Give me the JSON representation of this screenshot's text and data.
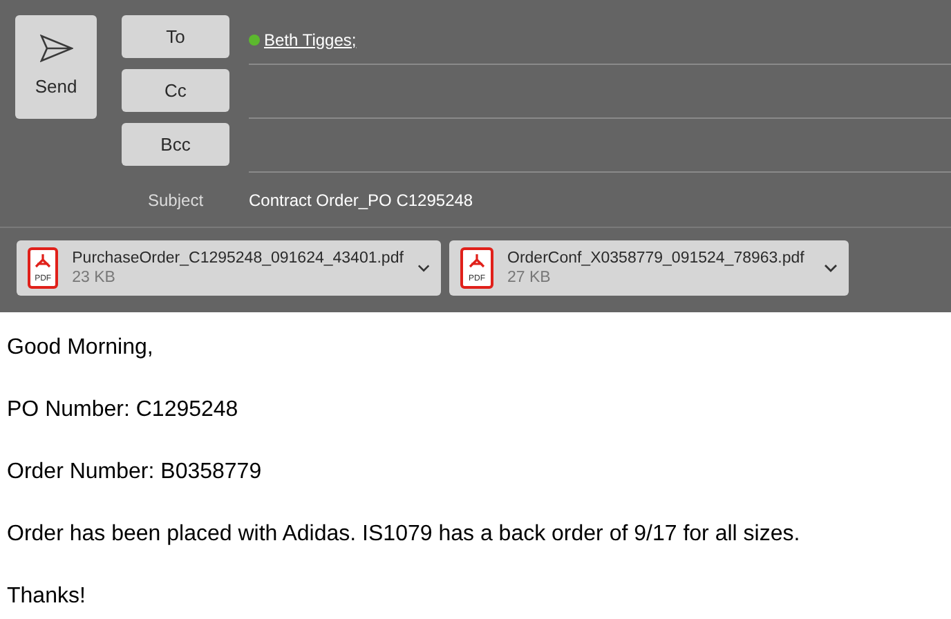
{
  "send_button": {
    "label": "Send"
  },
  "address_rows": [
    {
      "button": "To",
      "recipients": [
        {
          "name": "Beth Tigges;",
          "color": "#5cb82e"
        }
      ]
    },
    {
      "button": "Cc",
      "recipients": []
    },
    {
      "button": "Bcc",
      "recipients": []
    }
  ],
  "subject": {
    "label": "Subject",
    "value": "Contract Order_PO C1295248"
  },
  "attachments": [
    {
      "name": "PurchaseOrder_C1295248_091624_43401.pdf",
      "size": "23 KB",
      "icon_text": "PDF"
    },
    {
      "name": "OrderConf_X0358779_091524_78963.pdf",
      "size": "27 KB",
      "icon_text": "PDF"
    }
  ],
  "body": [
    "Good Morning,",
    "PO Number: C1295248",
    "Order Number: B0358779",
    "Order has been placed with Adidas. IS1079 has a back order of 9/17 for all sizes.",
    "Thanks!"
  ]
}
